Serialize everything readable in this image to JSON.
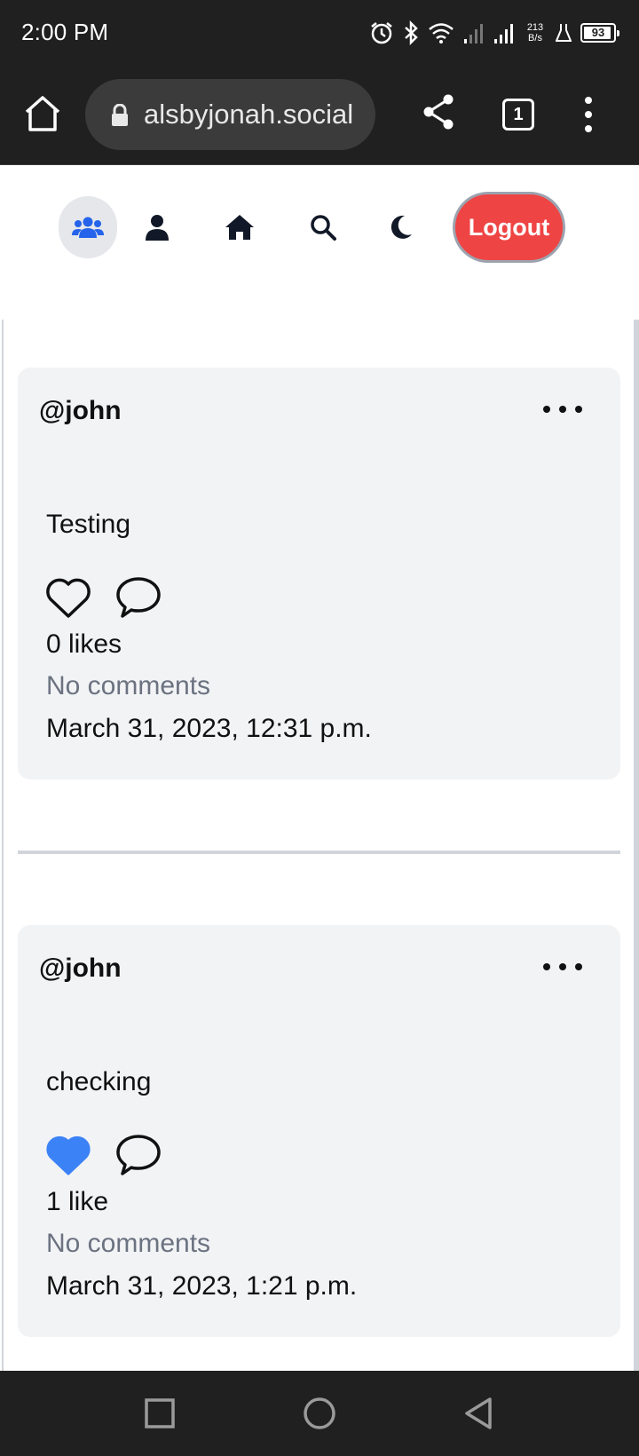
{
  "status_bar": {
    "time": "2:00 PM",
    "net_speed_value": "213",
    "net_speed_unit": "B/s",
    "battery": "93",
    "battery_level": 0.93
  },
  "browser": {
    "url": "alsbyjonah.social",
    "tab_count": "1"
  },
  "nav": {
    "logout_label": "Logout",
    "items": [
      "users-icon",
      "user-icon",
      "home-icon",
      "search-icon",
      "moon-icon"
    ],
    "accent_color": "#2563eb",
    "logout_color": "#ef4444"
  },
  "posts": [
    {
      "author": "@john",
      "body": "Testing",
      "liked": false,
      "likes": "0 likes",
      "comments": "No comments",
      "date": "March 31, 2023, 12:31 p.m."
    },
    {
      "author": "@john",
      "body": "checking",
      "liked": true,
      "likes": "1 like",
      "comments": "No comments",
      "date": "March 31, 2023, 1:21 p.m."
    }
  ],
  "colors": {
    "like_filled": "#3b82f6",
    "card_bg": "#f2f3f5"
  }
}
